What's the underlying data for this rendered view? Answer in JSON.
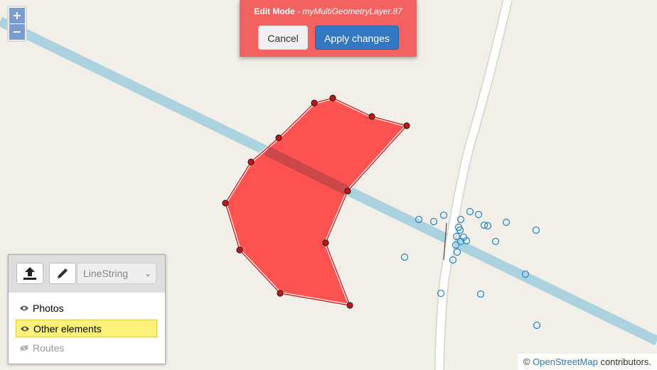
{
  "zoom": {
    "in_label": "+",
    "out_label": "−"
  },
  "edit_panel": {
    "mode_label": "Edit Mode",
    "separator": " - ",
    "layer_name": "myMultiGeometryLayer.87",
    "cancel_label": "Cancel",
    "apply_label": "Apply changes"
  },
  "controls": {
    "upload_icon": "upload-icon",
    "draw_icon": "pencil-icon",
    "geometry_type": "LineString",
    "layers": [
      {
        "label": "Photos",
        "visible": true,
        "active": false
      },
      {
        "label": "Other elements",
        "visible": true,
        "active": true
      },
      {
        "label": "Routes",
        "visible": false,
        "active": false
      }
    ]
  },
  "attribution": {
    "symbol": "© ",
    "link": "OpenStreetMap",
    "suffix": " contributors."
  },
  "colors": {
    "map_bg": "#f2efe9",
    "river": "#aad3df",
    "polygon_fill": "#ff4040",
    "panel": "#f36161",
    "apply": "#3378c2",
    "markers": "#2a8ac8",
    "highlight": "#fff27a"
  }
}
